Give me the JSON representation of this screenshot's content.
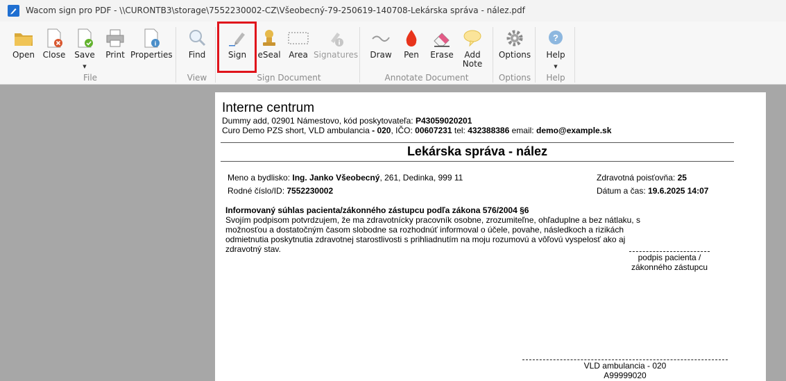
{
  "window": {
    "title": "Wacom sign pro PDF  - \\\\CURONTB3\\storage\\7552230002-CZ\\Všeobecný-79-250619-140708-Lekárska správa - nález.pdf",
    "app_icon": "wacom-pen-icon"
  },
  "toolbar": {
    "file": {
      "group_label": "File",
      "open": "Open",
      "close": "Close",
      "save": "Save",
      "print": "Print",
      "properties": "Properties"
    },
    "view": {
      "group_label": "View",
      "find": "Find"
    },
    "sign_document": {
      "group_label": "Sign Document",
      "sign": "Sign",
      "eseal": "eSeal",
      "area": "Area",
      "signatures": "Signatures"
    },
    "annotate": {
      "group_label": "Annotate Document",
      "draw": "Draw",
      "pen": "Pen",
      "erase": "Erase",
      "add_note_1": "Add",
      "add_note_2": "Note"
    },
    "options": {
      "group_label": "Options",
      "options": "Options"
    },
    "help": {
      "group_label": "Help",
      "help": "Help"
    }
  },
  "document": {
    "org_name": "Interne centrum",
    "org_address_prefix": "Dummy add, 02901 Námestovo, kód poskytovateľa: ",
    "provider_code": "P43059020201",
    "org_unit": "Curo Demo PZS short, VLD ambulancia",
    "org_unit_sep": " - ",
    "org_unit_code": "020",
    "ico_label": ", IČO: ",
    "ico": "00607231",
    "tel_label": " tel: ",
    "tel": "432388386",
    "email_label": " email: ",
    "email": "demo@example.sk",
    "title": "Lekárska správa - nález",
    "name_label": "Meno a bydlisko: ",
    "patient_name": "Ing. Janko Všeobecný",
    "patient_address": ", 261, Dedinka, 999 11",
    "id_label": "Rodné číslo/ID: ",
    "patient_id": "7552230002",
    "insurance_label": "Zdravotná poisťovňa: ",
    "insurance": "25",
    "datetime_label": "Dátum a čas: ",
    "datetime": "19.6.2025 14:07",
    "consent_heading": "Informovaný súhlas pacienta/zákonného zástupcu podľa zákona 576/2004 §6",
    "consent_body": "Svojím podpisom potvrdzujem, že ma zdravotnícky pracovník osobne, zrozumiteľne, ohľaduplne a bez nátlaku, s možnosťou a dostatočným časom slobodne sa rozhodnúť informoval o účele, povahe, následkoch a rizikách odmietnutia poskytnutia zdravotnej starostlivosti s prihliadnutím na moju rozumovú a vôľovú vyspelosť ako aj zdravotný stav.",
    "patient_signature_label": "podpis pacienta / zákonného zástupcu",
    "doctor_unit": "VLD ambulancia - 020",
    "doctor_code": "A99999020"
  },
  "colors": {
    "highlight": "#e0141b",
    "ribbon_bg": "#f7f7f7",
    "viewer_bg": "#a7a7a7"
  }
}
